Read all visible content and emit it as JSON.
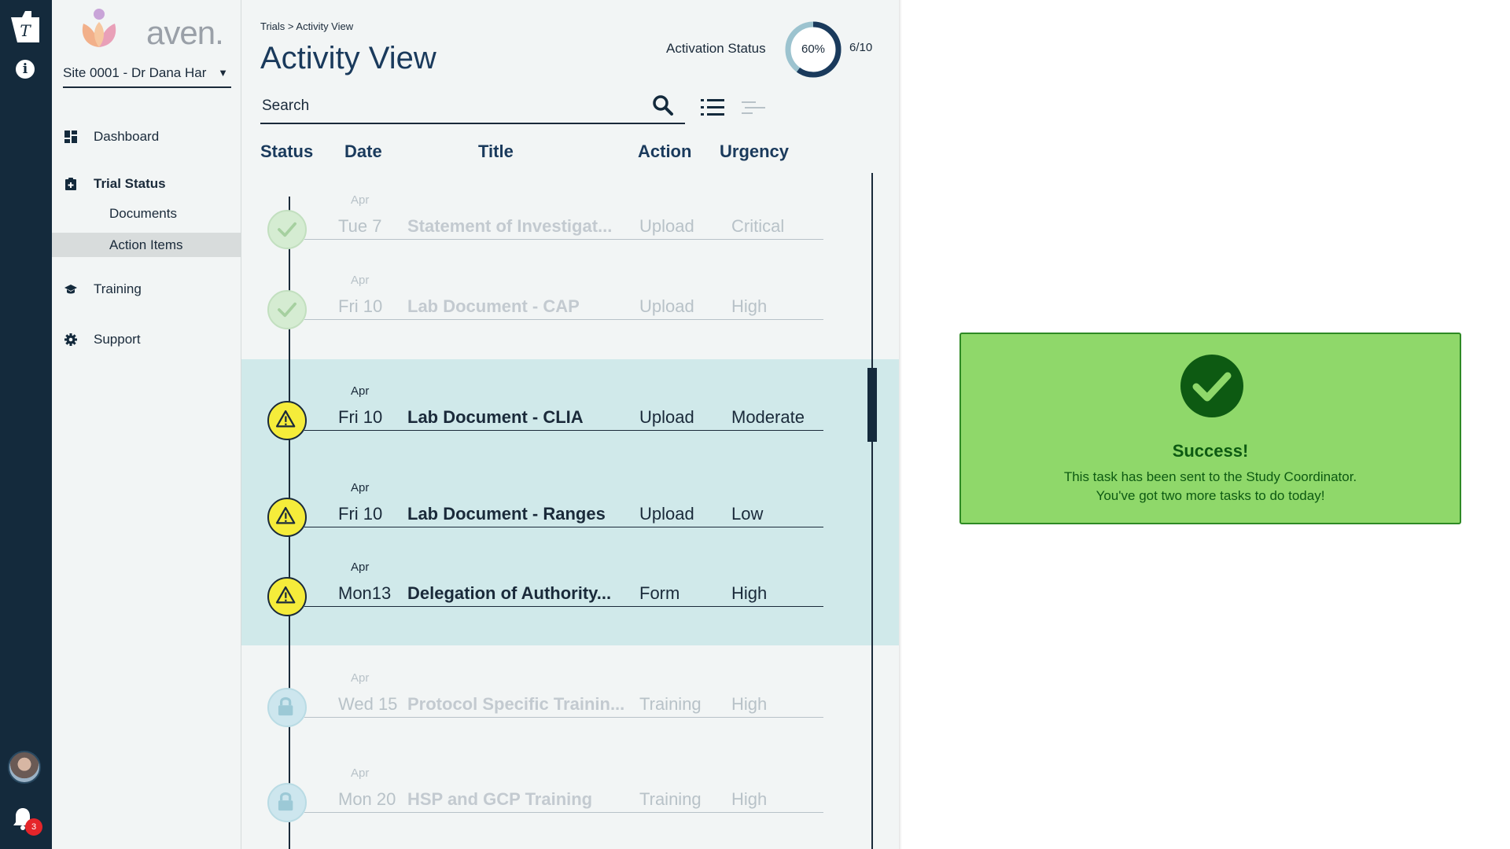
{
  "app": {
    "brand": "aven."
  },
  "rail": {
    "notification_count": "3"
  },
  "sidebar": {
    "site": "Site 0001 - Dr Dana Har",
    "items": [
      {
        "label": "Dashboard",
        "icon": "dashboard-icon"
      },
      {
        "label": "Trial Status",
        "icon": "clipboard-icon"
      },
      {
        "label": "Documents",
        "icon": ""
      },
      {
        "label": "Action Items",
        "icon": ""
      },
      {
        "label": "Training",
        "icon": "graduation-cap-icon"
      },
      {
        "label": "Support",
        "icon": "gear-icon"
      }
    ]
  },
  "header": {
    "breadcrumb": "Trials > Activity View",
    "title": "Activity View",
    "activation_label": "Activation Status",
    "activation_percent": "60%",
    "activation_fraction": 0.6,
    "activation_count": "6/10"
  },
  "search": {
    "placeholder": "Search"
  },
  "columns": {
    "status": "Status",
    "date": "Date",
    "title": "Title",
    "action": "Action",
    "urgency": "Urgency"
  },
  "rows": [
    {
      "month": "Apr",
      "date": "Tue 7",
      "title": "Statement of Investigat...",
      "action": "Upload",
      "urgency": "Critical",
      "status": "done"
    },
    {
      "month": "Apr",
      "date": "Fri 10",
      "title": "Lab Document - CAP",
      "action": "Upload",
      "urgency": "High",
      "status": "done"
    },
    {
      "month": "Apr",
      "date": "Fri 10",
      "title": "Lab Document - CLIA",
      "action": "Upload",
      "urgency": "Moderate",
      "status": "warning"
    },
    {
      "month": "Apr",
      "date": "Fri 10",
      "title": "Lab Document - Ranges",
      "action": "Upload",
      "urgency": "Low",
      "status": "warning"
    },
    {
      "month": "Apr",
      "date": "Mon13",
      "title": "Delegation of Authority...",
      "action": "Form",
      "urgency": "High",
      "status": "warning"
    },
    {
      "month": "Apr",
      "date": "Wed 15",
      "title": "Protocol Specific Trainin...",
      "action": "Training",
      "urgency": "High",
      "status": "locked"
    },
    {
      "month": "Apr",
      "date": "Mon 20",
      "title": "HSP and GCP Training",
      "action": "Training",
      "urgency": "High",
      "status": "locked"
    }
  ],
  "toast": {
    "title": "Success!",
    "line1": "This task has been sent to the Study Coordinator.",
    "line2": "You've got two more tasks to do today!"
  },
  "colors": {
    "rail": "#142a3c",
    "highlight": "#d0e9ea",
    "success": "#8fd86a",
    "warning": "#f5ec3a",
    "accent": "#1a3a5c"
  }
}
